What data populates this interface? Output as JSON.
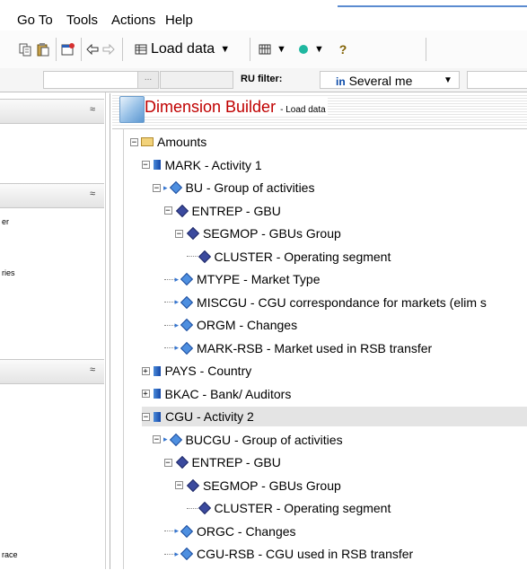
{
  "menu": {
    "items": [
      "Go To",
      "Tools",
      "Actions",
      "Help"
    ]
  },
  "toolbar": {
    "load_label": "Load data"
  },
  "filterbar": {
    "ru_label": "RU filter:",
    "several_prefix": "in",
    "several_text": "Several me",
    "input_button": "..."
  },
  "leftpanel": {
    "fragments": [
      "er",
      "ries",
      "race"
    ]
  },
  "builder": {
    "title": "Dimension Builder",
    "subtitle": "- Load data"
  },
  "tree": [
    {
      "label": "Amounts",
      "icon": "folder",
      "expander": "minus"
    },
    {
      "label": "MARK - Activity 1",
      "icon": "blue",
      "expander": "minus"
    },
    {
      "label": "BU - Group of activities",
      "icon": "arrow-diamond",
      "expander": "minus"
    },
    {
      "label": "ENTREP - GBU",
      "icon": "diamond-dark",
      "expander": "minus"
    },
    {
      "label": "SEGMOP - GBUs Group",
      "icon": "diamond-dark",
      "expander": "minus"
    },
    {
      "label": "CLUSTER - Operating segment",
      "icon": "diamond-dark",
      "expander": "none"
    },
    {
      "label": "MTYPE - Market Type",
      "icon": "arrow-diamond",
      "expander": "none"
    },
    {
      "label": "MISCGU - CGU correspondance for markets (elim s",
      "icon": "arrow-diamond",
      "expander": "none"
    },
    {
      "label": "ORGM - Changes",
      "icon": "arrow-diamond",
      "expander": "none"
    },
    {
      "label": "MARK-RSB - Market used in RSB transfer",
      "icon": "arrow-diamond",
      "expander": "none"
    },
    {
      "label": "PAYS - Country",
      "icon": "blue",
      "expander": "plus"
    },
    {
      "label": "BKAC - Bank/ Auditors",
      "icon": "blue",
      "expander": "plus"
    },
    {
      "label": "CGU - Activity 2",
      "icon": "blue",
      "expander": "minus"
    },
    {
      "label": "BUCGU - Group of activities",
      "icon": "arrow-diamond",
      "expander": "minus"
    },
    {
      "label": "ENTREP - GBU",
      "icon": "diamond-dark",
      "expander": "minus"
    },
    {
      "label": "SEGMOP - GBUs Group",
      "icon": "diamond-dark",
      "expander": "minus"
    },
    {
      "label": "CLUSTER - Operating segment",
      "icon": "diamond-dark",
      "expander": "none"
    },
    {
      "label": "ORGC - Changes",
      "icon": "arrow-diamond",
      "expander": "none"
    },
    {
      "label": "CGU-RSB - CGU used in RSB transfer",
      "icon": "arrow-diamond",
      "expander": "none"
    }
  ]
}
